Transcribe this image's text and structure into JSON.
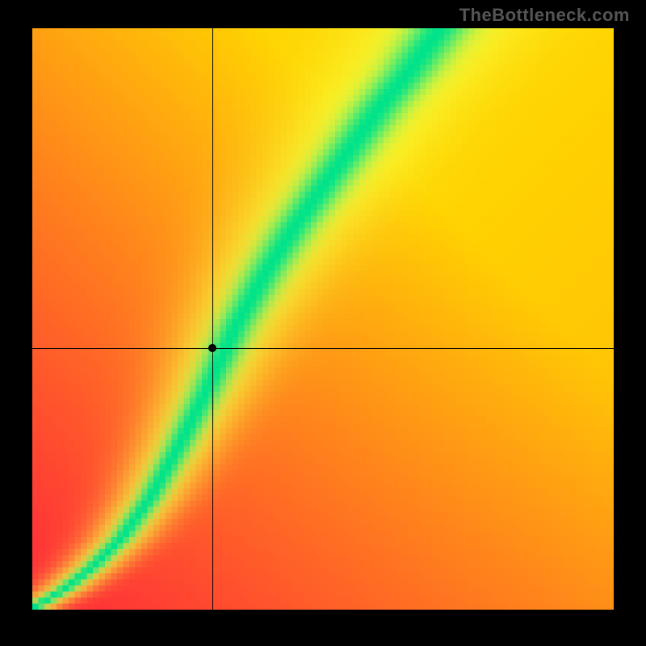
{
  "watermark": "TheBottleneck.com",
  "chart_data": {
    "type": "heatmap",
    "title": "",
    "xlabel": "",
    "ylabel": "",
    "xlim": [
      0,
      1
    ],
    "ylim": [
      0,
      1
    ],
    "grid": false,
    "legend": false,
    "gradient": {
      "bg_tl": "#ff2b3a",
      "bg_br": "#ffd400",
      "ridge_core": "#00e38a",
      "ridge_halo": "#f7ff3d"
    },
    "ridge_curve_xy": [
      [
        0.0,
        0.0
      ],
      [
        0.05,
        0.03
      ],
      [
        0.1,
        0.07
      ],
      [
        0.15,
        0.12
      ],
      [
        0.2,
        0.19
      ],
      [
        0.25,
        0.28
      ],
      [
        0.3,
        0.38
      ],
      [
        0.35,
        0.49
      ],
      [
        0.4,
        0.58
      ],
      [
        0.45,
        0.66
      ],
      [
        0.5,
        0.73
      ],
      [
        0.55,
        0.8
      ],
      [
        0.6,
        0.87
      ],
      [
        0.65,
        0.93
      ],
      [
        0.7,
        1.0
      ]
    ],
    "ridge_width_fraction": 0.06,
    "crosshair": {
      "x": 0.31,
      "y": 0.45
    },
    "marker": {
      "x": 0.31,
      "y": 0.45
    },
    "pixel_resolution": 96
  }
}
